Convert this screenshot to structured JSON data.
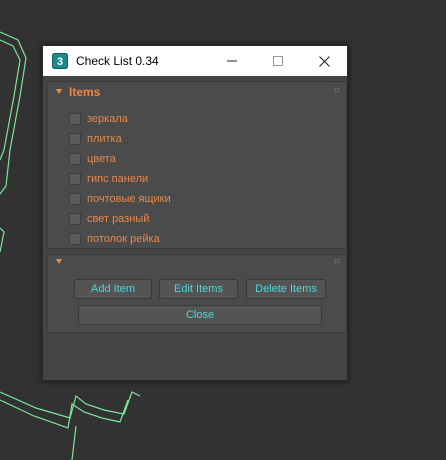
{
  "window": {
    "title": "Check List 0.34",
    "icon": "3dsmax-app-icon",
    "controls": [
      "minimize-icon",
      "maximize-icon",
      "close-icon"
    ]
  },
  "items_rollout": {
    "title": "Items",
    "items": [
      {
        "label": "зеркала",
        "checked": false
      },
      {
        "label": "плитка",
        "checked": false
      },
      {
        "label": "цвета",
        "checked": false
      },
      {
        "label": "гипс панели",
        "checked": false
      },
      {
        "label": "почтовые ящики",
        "checked": false
      },
      {
        "label": "свет разный",
        "checked": false
      },
      {
        "label": "потолок рейка",
        "checked": false
      }
    ]
  },
  "actions_rollout": {
    "add_label": "Add Item",
    "edit_label": "Edit Items",
    "delete_label": "Delete Items",
    "close_label": "Close"
  },
  "colors": {
    "accent_orange": "#e8884a",
    "button_text_cyan": "#4ad9d9",
    "panel_bg": "#444444",
    "viewport_wire": "#7ee39a"
  }
}
